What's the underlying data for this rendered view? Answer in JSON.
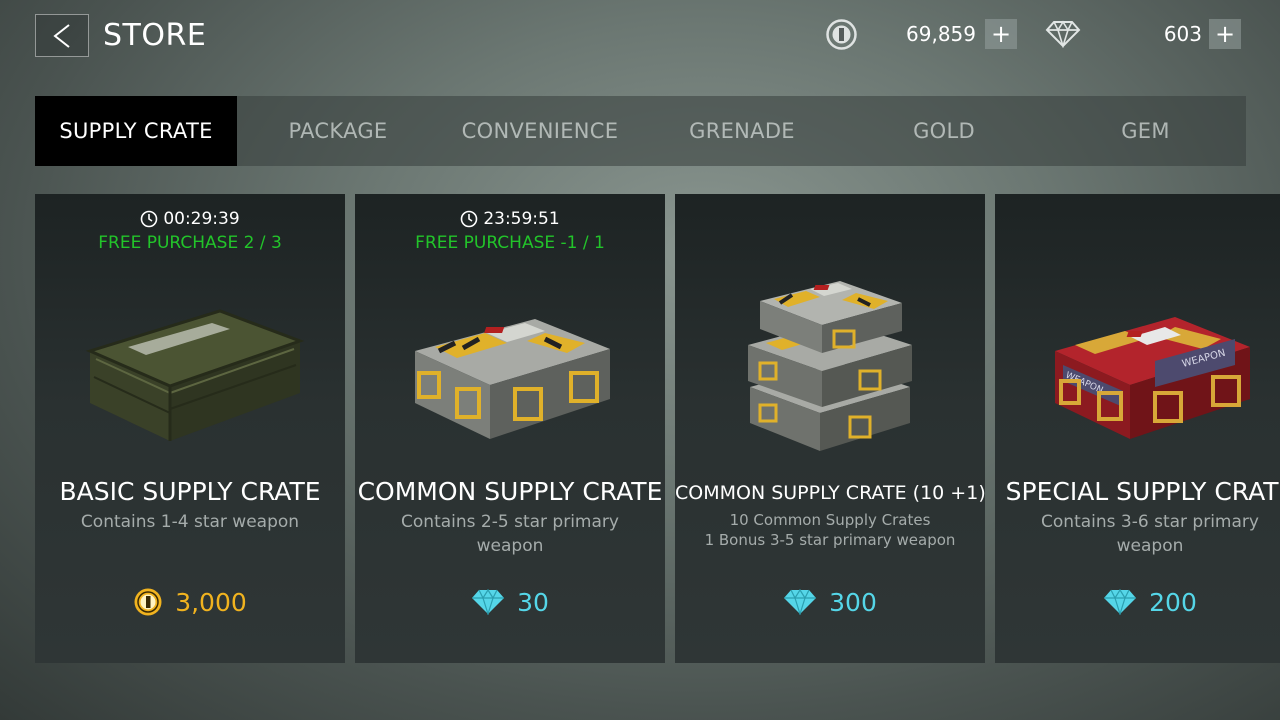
{
  "header": {
    "title": "STORE",
    "coins": "69,859",
    "gems": "603",
    "plus_label": "+"
  },
  "tabs": [
    {
      "label": "SUPPLY CRATE",
      "active": true
    },
    {
      "label": "PACKAGE",
      "active": false
    },
    {
      "label": "CONVENIENCE",
      "active": false
    },
    {
      "label": "GRENADE",
      "active": false
    },
    {
      "label": "GOLD",
      "active": false
    },
    {
      "label": "GEM",
      "active": false
    }
  ],
  "cards": [
    {
      "timer": "00:29:39",
      "free_purchase": "FREE PURCHASE 2 / 3",
      "title": "BASIC SUPPLY CRATE",
      "description": "Contains 1-4 star weapon",
      "price": "3,000",
      "currency": "gold-coin"
    },
    {
      "timer": "23:59:51",
      "free_purchase": "FREE PURCHASE -1 / 1",
      "title": "COMMON SUPPLY CRATE",
      "description": "Contains 2-5 star primary weapon",
      "price": "30",
      "currency": "gem"
    },
    {
      "title": "COMMON SUPPLY CRATE (10 +1)",
      "description_line1": "10 Common Supply Crates",
      "description_line2": "1 Bonus 3-5 star primary weapon",
      "price": "300",
      "currency": "gem"
    },
    {
      "title": "SPECIAL SUPPLY CRATE",
      "description": "Contains 3-6 star primary weapon",
      "price": "200",
      "currency": "gem",
      "crate_labels": [
        "WEAPON",
        "WEAPON"
      ]
    }
  ],
  "colors": {
    "free_green": "#22c42a",
    "gold_price": "#f1b31f",
    "gem_price": "#55d6e8",
    "active_tab_bg": "#000000"
  }
}
